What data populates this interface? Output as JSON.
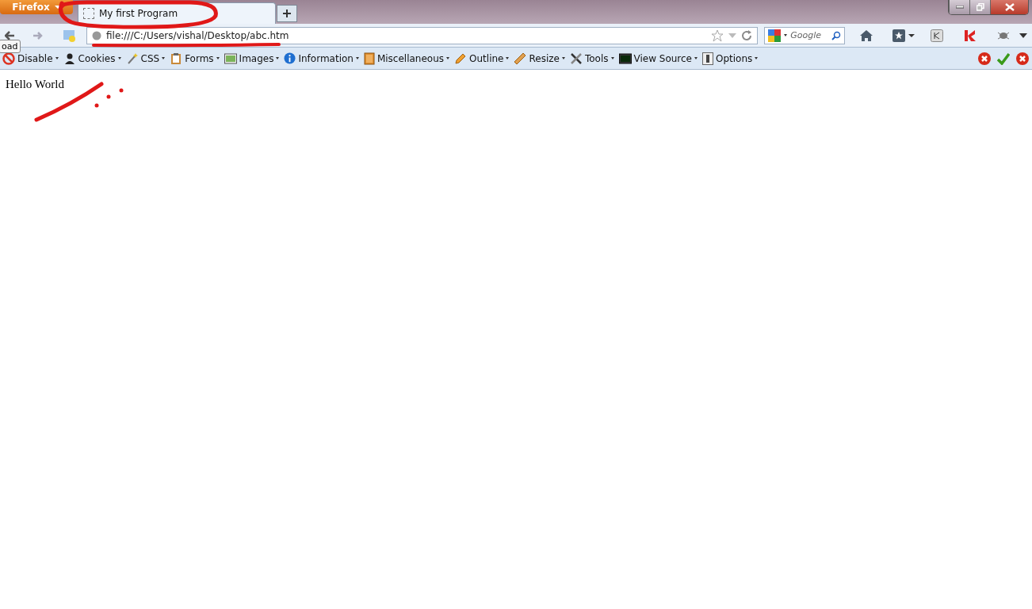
{
  "window": {
    "app_button": "Firefox"
  },
  "tabs": [
    {
      "title": "My first Program",
      "selected": true
    }
  ],
  "nav": {
    "url": "file:///C:/Users/vishal/Desktop/abc.htm",
    "search_placeholder": "Google",
    "tooltip": "oad"
  },
  "toolbar": [
    {
      "label": "Disable"
    },
    {
      "label": "Cookies"
    },
    {
      "label": "CSS"
    },
    {
      "label": "Forms"
    },
    {
      "label": "Images"
    },
    {
      "label": "Information"
    },
    {
      "label": "Miscellaneous"
    },
    {
      "label": "Outline"
    },
    {
      "label": "Resize"
    },
    {
      "label": "Tools"
    },
    {
      "label": "View Source"
    },
    {
      "label": "Options"
    }
  ],
  "page": {
    "text": "Hello World"
  }
}
